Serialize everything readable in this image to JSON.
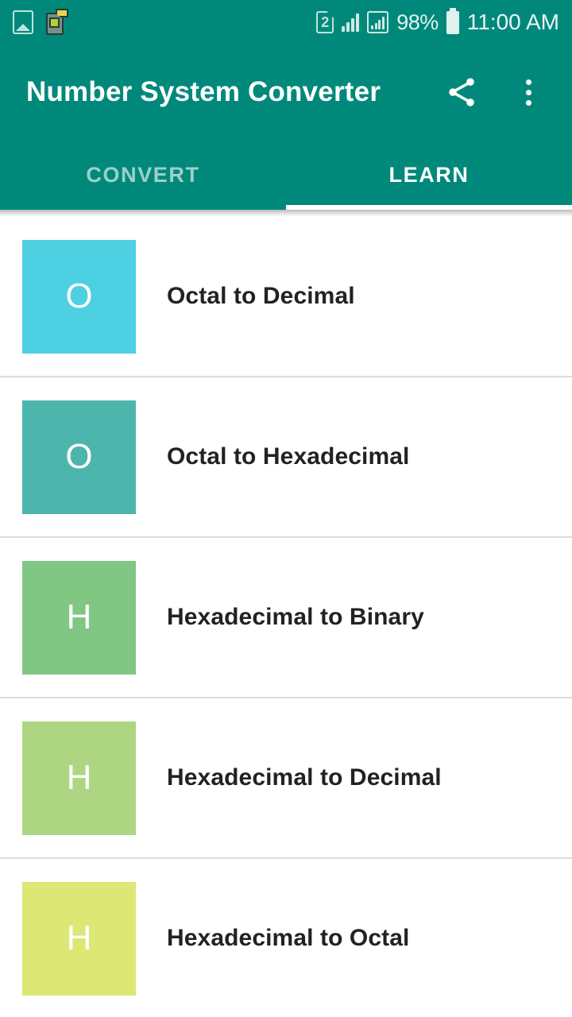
{
  "status_bar": {
    "left_icons": [
      "image-screenshot-icon",
      "app-notification-icon"
    ],
    "sim_label": "2",
    "battery_percent": "98%",
    "time": "11:00 AM",
    "background_color": "#00897b"
  },
  "app_bar": {
    "title": "Number System Converter",
    "share_label": "share-icon",
    "overflow_label": "more-options-icon",
    "background_color": "#00897b"
  },
  "tabs": {
    "items": [
      {
        "label": "CONVERT",
        "active": false
      },
      {
        "label": "LEARN",
        "active": true
      }
    ],
    "indicator_color": "#ffffff"
  },
  "list": {
    "items": [
      {
        "badge": "O",
        "label": "Octal to Decimal",
        "color": "#4dd0e1"
      },
      {
        "badge": "O",
        "label": "Octal to Hexadecimal",
        "color": "#4db6ac"
      },
      {
        "badge": "H",
        "label": "Hexadecimal to Binary",
        "color": "#81c784"
      },
      {
        "badge": "H",
        "label": "Hexadecimal to Decimal",
        "color": "#aed581"
      },
      {
        "badge": "H",
        "label": "Hexadecimal to Octal",
        "color": "#dce775"
      }
    ]
  }
}
